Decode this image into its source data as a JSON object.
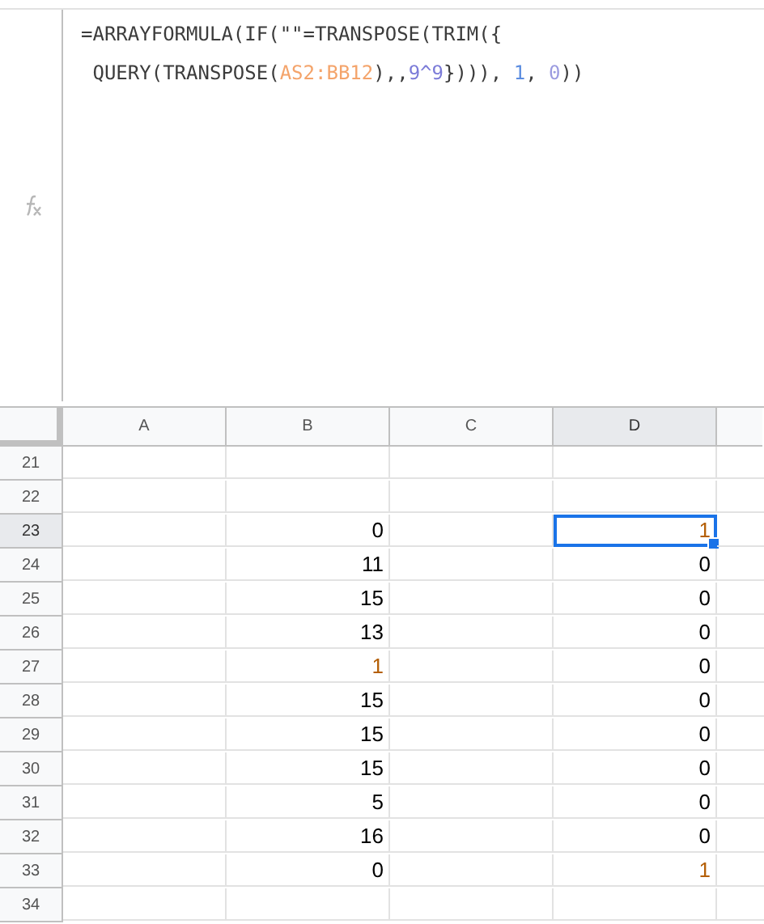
{
  "formula_bar": {
    "lines": [
      [
        {
          "text": "=ARRAYFORMULA(IF(\"\"=TRANSPOSE(TRIM({",
          "color": "#3c3c3c"
        }
      ],
      [
        {
          "text": " QUERY(TRANSPOSE(",
          "color": "#3c3c3c"
        },
        {
          "text": "AS2:BB12",
          "color": "#f4a46b"
        },
        {
          "text": "),,",
          "color": "#3c3c3c"
        },
        {
          "text": "9^9",
          "color": "#7b7bd8"
        },
        {
          "text": "}))), ",
          "color": "#3c3c3c"
        },
        {
          "text": "1",
          "color": "#5c8de0"
        },
        {
          "text": ", ",
          "color": "#3c3c3c"
        },
        {
          "text": "0",
          "color": "#9b9be0"
        },
        {
          "text": "))",
          "color": "#3c3c3c"
        }
      ]
    ]
  },
  "sheet": {
    "columns": [
      {
        "label": "A",
        "selected": false
      },
      {
        "label": "B",
        "selected": false
      },
      {
        "label": "C",
        "selected": false
      },
      {
        "label": "D",
        "selected": true
      }
    ],
    "rows": [
      {
        "number": "21",
        "selected": false,
        "cells": [
          null,
          null,
          null,
          null
        ]
      },
      {
        "number": "22",
        "selected": false,
        "cells": [
          null,
          null,
          null,
          null
        ]
      },
      {
        "number": "23",
        "selected": true,
        "cells": [
          null,
          {
            "value": "0",
            "color": "#000000"
          },
          null,
          {
            "value": "1",
            "color": "#b45f06"
          }
        ]
      },
      {
        "number": "24",
        "selected": false,
        "cells": [
          null,
          {
            "value": "11",
            "color": "#000000"
          },
          null,
          {
            "value": "0",
            "color": "#000000"
          }
        ]
      },
      {
        "number": "25",
        "selected": false,
        "cells": [
          null,
          {
            "value": "15",
            "color": "#000000"
          },
          null,
          {
            "value": "0",
            "color": "#000000"
          }
        ]
      },
      {
        "number": "26",
        "selected": false,
        "cells": [
          null,
          {
            "value": "13",
            "color": "#000000"
          },
          null,
          {
            "value": "0",
            "color": "#000000"
          }
        ]
      },
      {
        "number": "27",
        "selected": false,
        "cells": [
          null,
          {
            "value": "1",
            "color": "#b45f06"
          },
          null,
          {
            "value": "0",
            "color": "#000000"
          }
        ]
      },
      {
        "number": "28",
        "selected": false,
        "cells": [
          null,
          {
            "value": "15",
            "color": "#000000"
          },
          null,
          {
            "value": "0",
            "color": "#000000"
          }
        ]
      },
      {
        "number": "29",
        "selected": false,
        "cells": [
          null,
          {
            "value": "15",
            "color": "#000000"
          },
          null,
          {
            "value": "0",
            "color": "#000000"
          }
        ]
      },
      {
        "number": "30",
        "selected": false,
        "cells": [
          null,
          {
            "value": "15",
            "color": "#000000"
          },
          null,
          {
            "value": "0",
            "color": "#000000"
          }
        ]
      },
      {
        "number": "31",
        "selected": false,
        "cells": [
          null,
          {
            "value": "5",
            "color": "#000000"
          },
          null,
          {
            "value": "0",
            "color": "#000000"
          }
        ]
      },
      {
        "number": "32",
        "selected": false,
        "cells": [
          null,
          {
            "value": "16",
            "color": "#000000"
          },
          null,
          {
            "value": "0",
            "color": "#000000"
          }
        ]
      },
      {
        "number": "33",
        "selected": false,
        "cells": [
          null,
          {
            "value": "0",
            "color": "#000000"
          },
          null,
          {
            "value": "1",
            "color": "#b45f06"
          }
        ]
      },
      {
        "number": "34",
        "selected": false,
        "cells": [
          null,
          null,
          null,
          null
        ]
      }
    ]
  }
}
